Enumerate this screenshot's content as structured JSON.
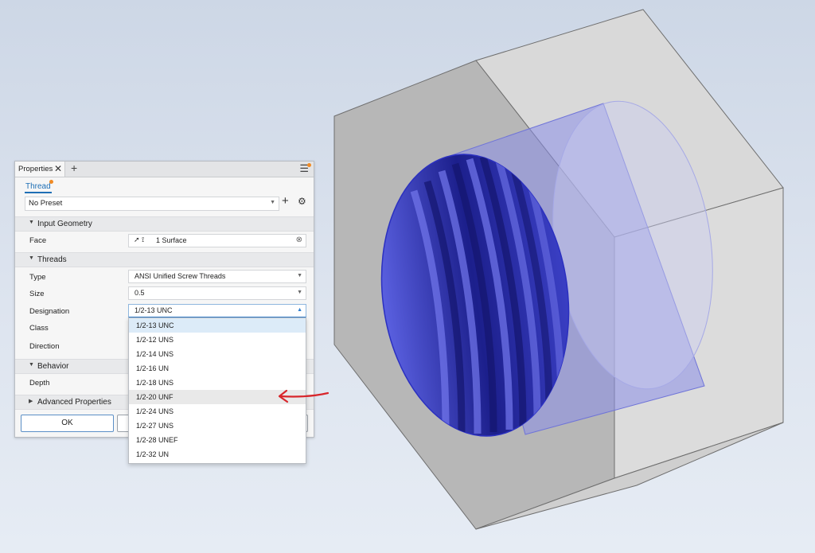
{
  "panel": {
    "tab_label": "Properties",
    "tab_close": "✕",
    "tab_add": "+",
    "menu_icon": "☰",
    "subtab": "Thread",
    "preset": "No Preset",
    "preset_add": "+",
    "preset_settings": "⚙",
    "sections": {
      "input_geometry": "Input Geometry",
      "threads": "Threads",
      "behavior": "Behavior",
      "advanced": "Advanced Properties"
    },
    "labels": {
      "face": "Face",
      "type": "Type",
      "size": "Size",
      "designation": "Designation",
      "class": "Class",
      "direction": "Direction",
      "depth": "Depth"
    },
    "values": {
      "face": "1 Surface",
      "type": "ANSI Unified Screw Threads",
      "size": "0.5",
      "designation": "1/2-13 UNC"
    },
    "ok_button": "OK"
  },
  "dropdown": {
    "options": [
      "1/2-13 UNC",
      "1/2-12 UNS",
      "1/2-14 UNS",
      "1/2-16 UN",
      "1/2-18 UNS",
      "1/2-20 UNF",
      "1/2-24 UNS",
      "1/2-27 UNS",
      "1/2-28 UNEF",
      "1/2-32 UN"
    ],
    "selected_index": 0,
    "highlighted_index": 5
  },
  "colors": {
    "accent": "#1f6fb5",
    "notification": "#f08a24",
    "annotation_arrow": "#d8262b",
    "thread_blue": "#2a2fb8"
  }
}
